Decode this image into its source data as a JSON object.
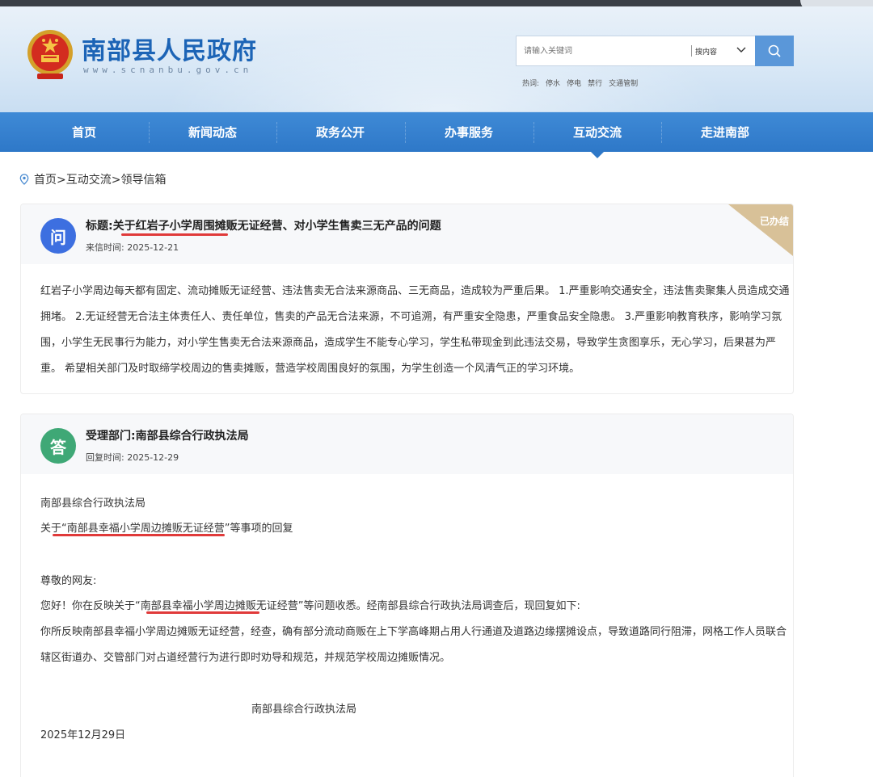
{
  "site": {
    "title": "南部县人民政府",
    "url": "www.scnanbu.gov.cn",
    "search_placeholder": "请输入关键词",
    "search_scope": "搜内容",
    "hot_label": "热词:",
    "hot_words": [
      "停水",
      "停电",
      "禁行",
      "交通管制"
    ]
  },
  "nav": {
    "items": [
      "首页",
      "新闻动态",
      "政务公开",
      "办事服务",
      "互动交流",
      "走进南部"
    ],
    "active": "互动交流"
  },
  "breadcrumb": "首页>互动交流>领导信箱",
  "question": {
    "badge": "问",
    "title_prefix": "标题:",
    "title": "关于红岩子小学周围摊贩无证经营、对小学生售卖三无产品的问题",
    "date_label": "来信时间:",
    "date": "2025-12-21",
    "status": "已办结",
    "body_lines": [
      "红岩子小学周边每天都有固定、流动摊贩无证经营、违法售卖无合法来源商品、三无商品，造成较为严重后果。 1.严重影响交通安全，违法售卖聚集人员造成交通",
      "拥堵。 2.无证经营无合法主体责任人、责任单位，售卖的产品无合法来源，不可追溯，有严重安全隐患，严重食品安全隐患。 3.严重影响教育秩序，影响学习氛",
      "围，小学生无民事行为能力，对小学生售卖无合法来源商品，造成学生不能专心学习，学生私带现金到此违法交易，导致学生贪图享乐，无心学习，后果甚为严",
      "重。 希望相关部门及时取缔学校周边的售卖摊贩，营造学校周围良好的氛围，为学生创造一个风清气正的学习环境。"
    ]
  },
  "answer": {
    "badge": "答",
    "dept_prefix": "受理部门:",
    "dept": "南部县综合行政执法局",
    "date_label": "回复时间:",
    "date": "2025-12-29",
    "lines": {
      "org": "南部县综合行政执法局",
      "subject": "关于“南部县幸福小学周边摊贩无证经营”等事项的回复",
      "greeting": "尊敬的网友:",
      "p1": "您好！你在反映关于“南部县幸福小学周边摊贩无证经营”等问题收悉。经南部县综合行政执法局调查后，现回复如下:",
      "p2a": "你所反映南部县幸福小学周边摊贩无证经营，经查，确有部分流动商贩在上下学高峰期占用人行通道及道路边缘摆摊设点，导致道路同行阻滞，网格工作人员联合",
      "p2b": "辖区街道办、交管部门对占道经营行为进行即时劝导和规范，并规范学校周边摊贩情况。",
      "signature": "南部县综合行政执法局",
      "sign_date": "2025年12月29日"
    }
  },
  "colors": {
    "brand_blue": "#1c64b6",
    "nav_blue": "#2e78c8",
    "question_badge": "#3d6fe0",
    "answer_badge": "#3fa876",
    "status_ribbon": "#d8c198",
    "annotation_red": "#e03a3a"
  }
}
